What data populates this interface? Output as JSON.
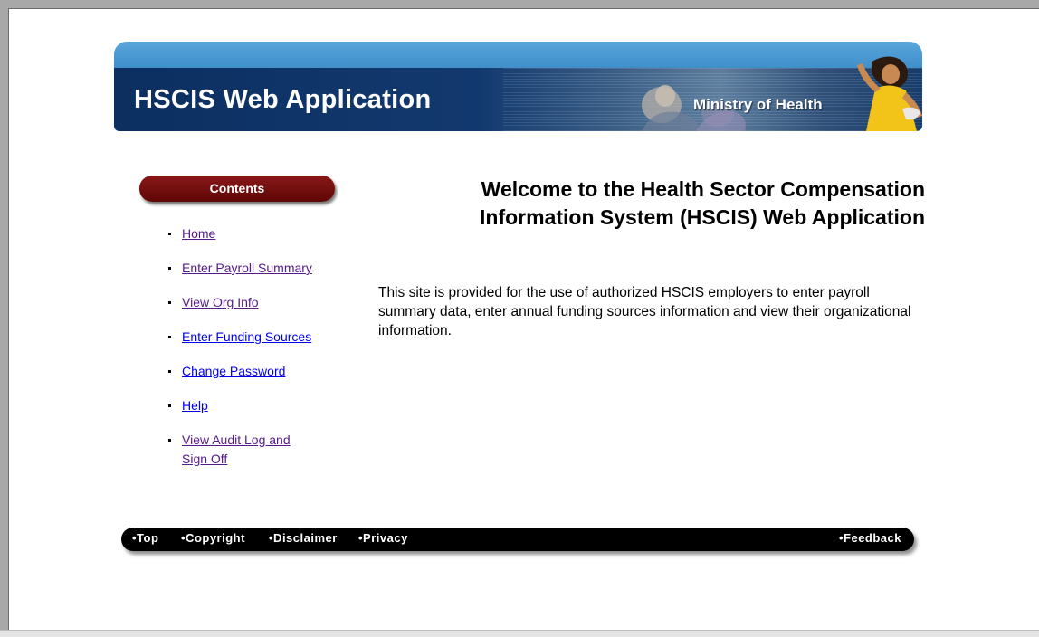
{
  "banner": {
    "title": "HSCIS Web Application",
    "subtitle": "Ministry of Health"
  },
  "sidebar": {
    "heading": "Contents",
    "items": [
      {
        "label": "Home",
        "visited": true
      },
      {
        "label": "Enter Payroll Summary",
        "visited": true
      },
      {
        "label": "View Org Info",
        "visited": true
      },
      {
        "label": "Enter Funding Sources",
        "visited": false
      },
      {
        "label": "Change Password",
        "visited": false
      },
      {
        "label": "Help",
        "visited": false
      },
      {
        "label": "View Audit Log and Sign Off",
        "visited": true
      }
    ]
  },
  "main": {
    "welcome": "Welcome to the Health Sector Compensation Information System (HSCIS) Web Application",
    "intro": "This site is provided for the use of authorized HSCIS employers to enter payroll summary data, enter annual funding sources information and view their organizational information."
  },
  "footer": {
    "top": "•Top",
    "copyright": "•Copyright",
    "disclaimer": "•Disclaimer",
    "privacy": "•Privacy",
    "feedback": "•Feedback"
  },
  "colors": {
    "banner_dark": "#0c2f60",
    "banner_light": "#4a9ad6",
    "contents_pill": "#6e0c0c",
    "link": "#0000ee",
    "link_visited": "#551a8b",
    "footer_bg": "#000000"
  }
}
